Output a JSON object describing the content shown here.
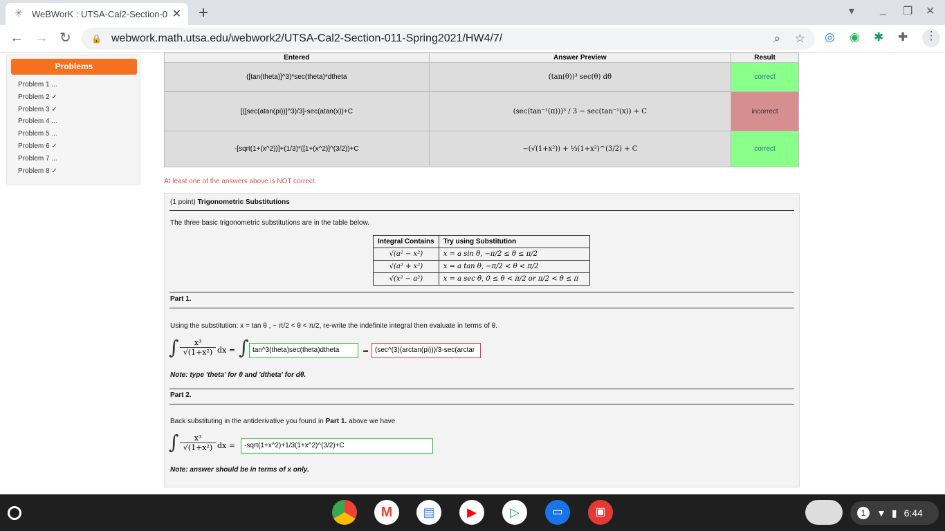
{
  "tab": {
    "title": "WeBWorK : UTSA-Cal2-Section-0",
    "close": "✕"
  },
  "toolbar": {
    "url": "webwork.math.utsa.edu/webwork2/UTSA-Cal2-Section-011-Spring2021/HW4/7/"
  },
  "sidebar": {
    "button": "Problems",
    "items": [
      "Problem 1 ...",
      "Problem 2 ✓",
      "Problem 3 ✓",
      "Problem 4 ...",
      "Problem 5 ...",
      "Problem 6 ✓",
      "Problem 7 ...",
      "Problem 8 ✓"
    ]
  },
  "results": {
    "headers": [
      "Entered",
      "Answer Preview",
      "Result"
    ],
    "rows": [
      {
        "entered": "([tan(theta)]^3)*sec(theta)*dtheta",
        "preview": "(tan(θ))³ sec(θ) dθ",
        "result": "correct"
      },
      {
        "entered": "[([sec(atan(pi))]^3)/3]-sec(atan(x))+C",
        "preview": "(sec(tan⁻¹(π)))³ / 3 − sec(tan⁻¹(x)) + C",
        "result": "incorrect"
      },
      {
        "entered": "-[sqrt(1+(x^2))]+(1/3)*([1+(x^2)]^(3/2))+C",
        "preview": "−(√(1+x²)) + ⅓(1+x²)^(3/2) + C",
        "result": "correct"
      }
    ]
  },
  "warning": "At least one of the answers above is NOT correct.",
  "problem": {
    "points": "(1 point)",
    "title": "Trigonometric Substitutions",
    "intro": "The three basic trigonometric substitutions are in the table below.",
    "table_headers": [
      "Integral Contains",
      "Try using Substitution"
    ],
    "table_rows": [
      [
        "√(a² − x²)",
        "x = a sin θ,   −π/2 ≤ θ ≤ π/2"
      ],
      [
        "√(a² + x²)",
        "x = a tan θ,   −π/2 < θ < π/2"
      ],
      [
        "√(x² − a²)",
        "x = a sec θ,   0 ≤ θ < π/2 or π/2 < θ ≤ π"
      ]
    ],
    "part1_title": "Part 1.",
    "part1_text": "Using the substitution: x = tan θ , − π/2 < θ < π/2, re-write the indefinite integral then evaluate in terms of θ.",
    "part1_answer1": "tan^3(theta)sec(theta)dtheta",
    "part1_answer2": "(sec^(3)(arctan(pi)))/3-sec(arctar",
    "part1_note": "Note: type 'theta' for θ and 'dtheta' for dθ.",
    "part2_title": "Part 2.",
    "part2_text_pre": "Back substituting in the antiderivative you found in",
    "part2_text_bold": "Part 1.",
    "part2_text_post": "above we have",
    "part2_answer": "-sqrt(1+x^2)+1/3(1+x^2)^(3/2)+C",
    "part2_note": "Note: answer should be in terms of x only.",
    "integrand_num": "x³",
    "integrand_den": "√(1+x²)",
    "dx": "dx ="
  },
  "shelf": {
    "time": "6:44",
    "notif": "1"
  }
}
